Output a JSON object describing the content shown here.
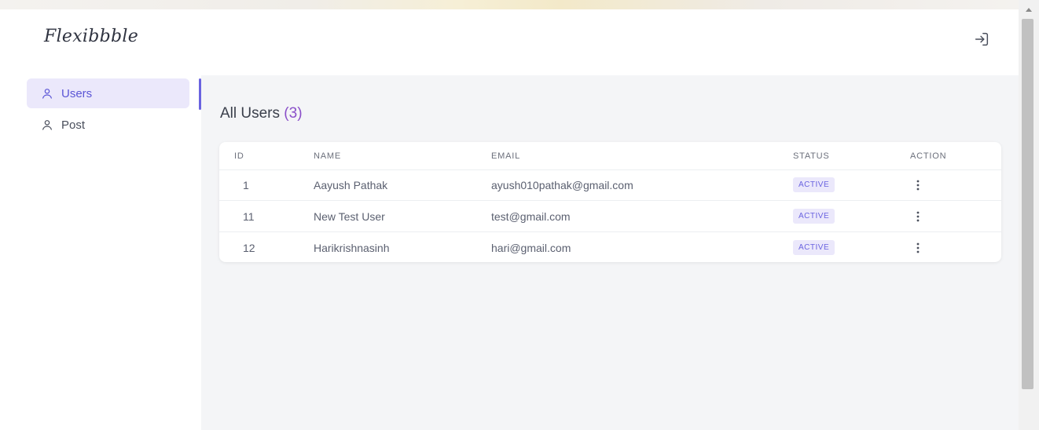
{
  "app": {
    "logo": "Flexibbble"
  },
  "sidebar": {
    "items": [
      {
        "label": "Users",
        "icon": "user-icon",
        "active": true
      },
      {
        "label": "Post",
        "icon": "user-icon",
        "active": false
      }
    ]
  },
  "main": {
    "title": "All Users",
    "count_open": "(",
    "count": "3",
    "count_close": ")"
  },
  "table": {
    "headers": [
      "ID",
      "NAME",
      "EMAIL",
      "STATUS",
      "ACTION"
    ],
    "rows": [
      {
        "id": "1",
        "name": "Aayush Pathak",
        "email": "ayush010pathak@gmail.com",
        "status": "ACTIVE"
      },
      {
        "id": "11",
        "name": "New Test User",
        "email": "test@gmail.com",
        "status": "ACTIVE"
      },
      {
        "id": "12",
        "name": "Harikrishnasinh",
        "email": "hari@gmail.com",
        "status": "ACTIVE"
      }
    ]
  },
  "colors": {
    "accent": "#6a63e0",
    "count": "#8a4fc9",
    "active_bg": "#ebe8fb",
    "main_bg": "#f4f5f7"
  },
  "icons": {
    "logout": "logout-icon",
    "row_action": "more-vertical-icon"
  }
}
